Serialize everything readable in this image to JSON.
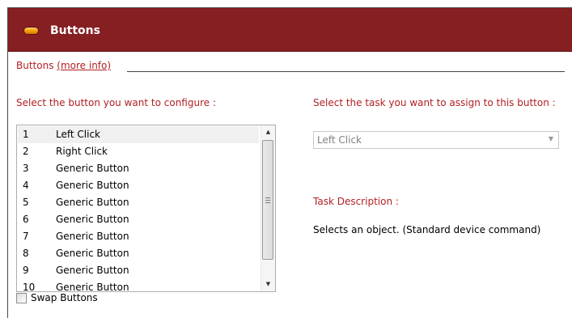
{
  "header": {
    "title": "Buttons",
    "accent_color": "#861f22",
    "icon": "orange-pill-icon"
  },
  "section": {
    "title": "Buttons",
    "more_info": "(more info)"
  },
  "left_prompt": "Select the button you want to configure :",
  "right_prompt": "Select the task you want to assign to this button :",
  "buttons_list": {
    "selected_index": 0,
    "items": [
      {
        "num": "1",
        "label": "Left Click"
      },
      {
        "num": "2",
        "label": "Right Click"
      },
      {
        "num": "3",
        "label": "Generic Button"
      },
      {
        "num": "4",
        "label": "Generic Button"
      },
      {
        "num": "5",
        "label": "Generic Button"
      },
      {
        "num": "6",
        "label": "Generic Button"
      },
      {
        "num": "7",
        "label": "Generic Button"
      },
      {
        "num": "8",
        "label": "Generic Button"
      },
      {
        "num": "9",
        "label": "Generic Button"
      },
      {
        "num": "10",
        "label": "Generic Button"
      }
    ]
  },
  "swap_buttons": {
    "label": "Swap Buttons",
    "checked": false
  },
  "task_select": {
    "value": "Left Click"
  },
  "task_description": {
    "label": "Task Description :",
    "text": "Selects an object. (Standard device command)"
  }
}
